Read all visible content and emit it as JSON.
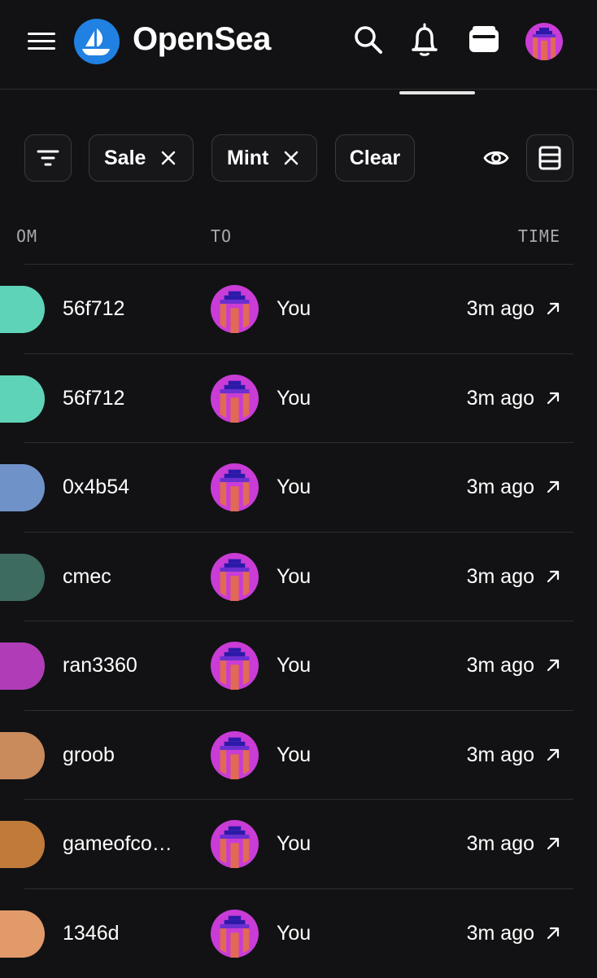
{
  "app": {
    "brand": "OpenSea"
  },
  "colors": {
    "background": "#121214",
    "accent": "#2081e2",
    "border": "#2e2e33"
  },
  "icons": {
    "menu": "hamburger-icon",
    "logo": "opensea-logo-icon",
    "search": "search-icon",
    "notifications": "bell-icon",
    "wallet": "wallet-icon",
    "filter": "filter-icon",
    "remove": "close-icon",
    "visibility": "eye-icon",
    "layout": "table-layout-icon",
    "open_link": "external-arrow-icon"
  },
  "filters": {
    "chips": [
      {
        "label": "Sale"
      },
      {
        "label": "Mint"
      }
    ],
    "clear_label": "Clear"
  },
  "table": {
    "columns": {
      "from": "OM",
      "to": "TO",
      "time": "TIME"
    },
    "rows": [
      {
        "from": "56f712",
        "to": "You",
        "time": "3m ago",
        "from_avatar_color": "#5fd3b8"
      },
      {
        "from": "56f712",
        "to": "You",
        "time": "3m ago",
        "from_avatar_color": "#5fd3b8"
      },
      {
        "from": "0x4b54",
        "to": "You",
        "time": "3m ago",
        "from_avatar_color": "#6f93c9"
      },
      {
        "from": "cmec",
        "to": "You",
        "time": "3m ago",
        "from_avatar_color": "#3d6b5f"
      },
      {
        "from": "ran3360",
        "to": "You",
        "time": "3m ago",
        "from_avatar_color": "#b03cb8"
      },
      {
        "from": "groob",
        "to": "You",
        "time": "3m ago",
        "from_avatar_color": "#c98a5c"
      },
      {
        "from": "gameofco…",
        "to": "You",
        "time": "3m ago",
        "from_avatar_color": "#c07a3a"
      },
      {
        "from": "1346d",
        "to": "You",
        "time": "3m ago",
        "from_avatar_color": "#e29a6a"
      }
    ]
  }
}
